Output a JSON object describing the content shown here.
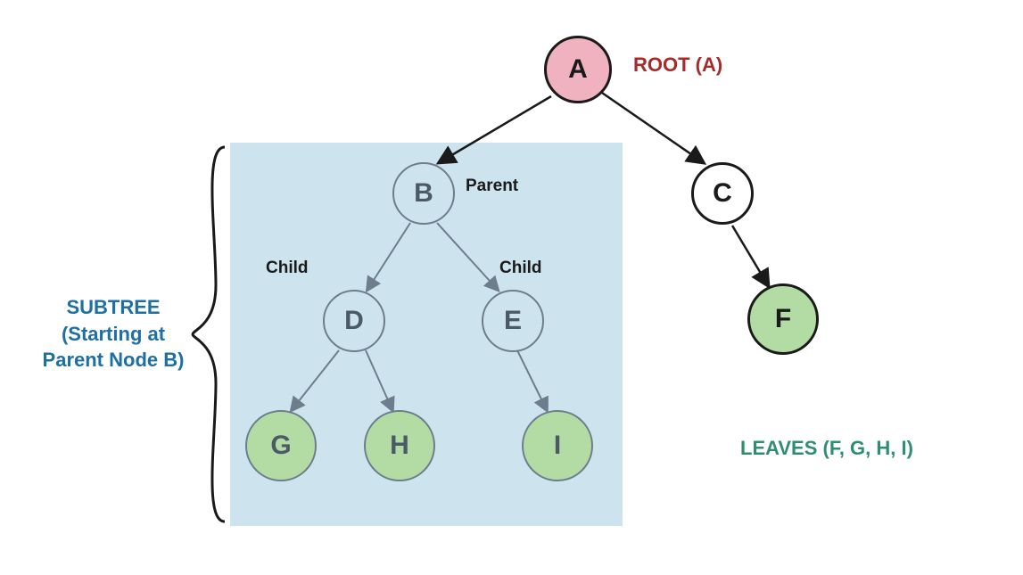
{
  "diagram": {
    "type": "tree",
    "nodes": {
      "A": {
        "label": "A",
        "role": "root",
        "children": [
          "B",
          "C"
        ]
      },
      "B": {
        "label": "B",
        "role": "internal",
        "children": [
          "D",
          "E"
        ],
        "annotation": "Parent"
      },
      "C": {
        "label": "C",
        "role": "internal",
        "children": [
          "F"
        ]
      },
      "D": {
        "label": "D",
        "role": "internal",
        "children": [
          "G",
          "H"
        ],
        "annotation": "Child"
      },
      "E": {
        "label": "E",
        "role": "internal",
        "children": [
          "I"
        ],
        "annotation": "Child"
      },
      "F": {
        "label": "F",
        "role": "leaf"
      },
      "G": {
        "label": "G",
        "role": "leaf"
      },
      "H": {
        "label": "H",
        "role": "leaf"
      },
      "I": {
        "label": "I",
        "role": "leaf"
      }
    },
    "subtree_root": "B",
    "leaves": [
      "F",
      "G",
      "H",
      "I"
    ]
  },
  "labels": {
    "root": "ROOT (A)",
    "parent": "Parent",
    "child_left": "Child",
    "child_right": "Child",
    "leaves": "LEAVES (F, G, H, I)",
    "subtree_line1": "SUBTREE",
    "subtree_line2": "(Starting at",
    "subtree_line3": "Parent Node B)"
  },
  "colors": {
    "root_fill": "#f0b2bf",
    "leaf_fill": "#b3dca4",
    "subtree_box": "#cde4ef",
    "root_text": "#a82b2b",
    "leaves_text": "#2f8e6f",
    "subtree_text": "#1e6fa3",
    "inner_stroke": "#6d7d8b"
  }
}
